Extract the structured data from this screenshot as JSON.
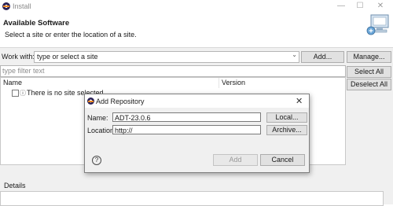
{
  "window": {
    "title": "Install",
    "minimize_icon": "minimize-icon",
    "maximize_icon": "maximize-icon",
    "close_icon": "close-icon"
  },
  "header": {
    "title": "Available Software",
    "description": "Select a site or enter the location of a site."
  },
  "work_with": {
    "label": "Work with:",
    "value": "type or select a site",
    "add_button": "Add...",
    "manage_button": "Manage..."
  },
  "filter": {
    "placeholder": "type filter text"
  },
  "side_buttons": {
    "select_all": "Select All",
    "deselect_all": "Deselect All"
  },
  "table": {
    "columns": [
      "Name",
      "Version"
    ],
    "rows": [
      {
        "name": "There is no site selected.",
        "icon": "info-icon",
        "checked": false
      }
    ]
  },
  "details": {
    "label": "Details"
  },
  "dialog": {
    "title": "Add Repository",
    "name_label": "Name:",
    "name_value": "ADT-23.0.6",
    "location_label": "Location:",
    "location_value": "http://",
    "local_button": "Local...",
    "archive_button": "Archive...",
    "add_button": "Add",
    "cancel_button": "Cancel",
    "help_icon": "help-icon"
  },
  "colors": {
    "dialog_border": "#7f7f7f",
    "button_face": "#e1e1e1",
    "window_bg": "#f0f0f0"
  }
}
